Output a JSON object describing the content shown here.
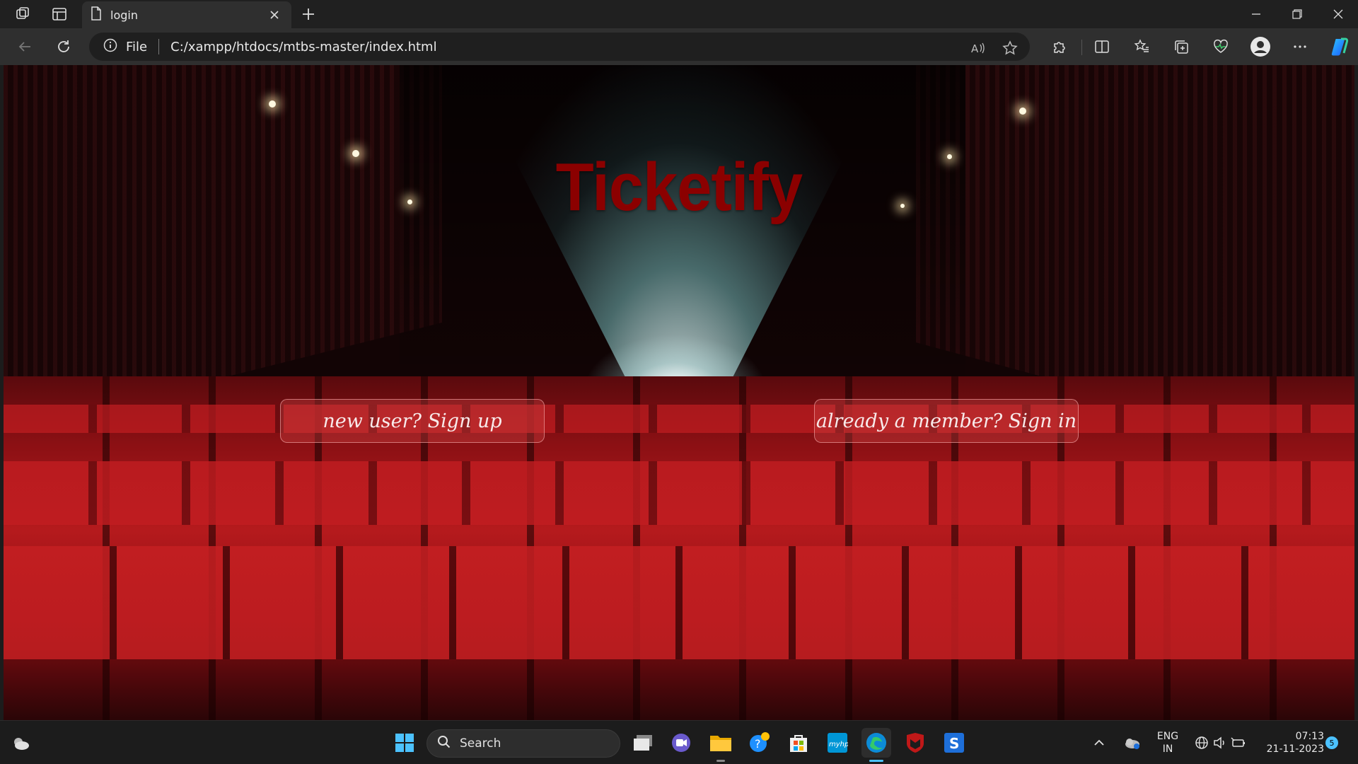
{
  "browser": {
    "tab_title": "login",
    "omnibox_scheme": "File",
    "url": "C:/xampp/htdocs/mtbs-master/index.html"
  },
  "page": {
    "site_title": "Ticketify",
    "signup_label": "new user? Sign up",
    "signin_label": "already a member? Sign in",
    "title_color": "#8b0000"
  },
  "taskbar": {
    "search_label": "Search",
    "language_line1": "ENG",
    "language_line2": "IN",
    "time": "07:13",
    "date": "21-11-2023",
    "notification_count": "5"
  },
  "icons": {
    "tab_actions": "workspaces-icon",
    "vertical_tabs": "tab-list-icon",
    "page": "page-icon",
    "info": "info-icon",
    "read_aloud": "read-aloud-icon",
    "favorite": "star-icon",
    "extensions": "puzzle-icon",
    "split": "split-screen-icon",
    "favorites": "favorites-icon",
    "collections": "collections-icon",
    "performance": "heartbeat-icon",
    "profile": "profile-icon",
    "more": "more-icon",
    "copilot": "copilot-icon"
  }
}
